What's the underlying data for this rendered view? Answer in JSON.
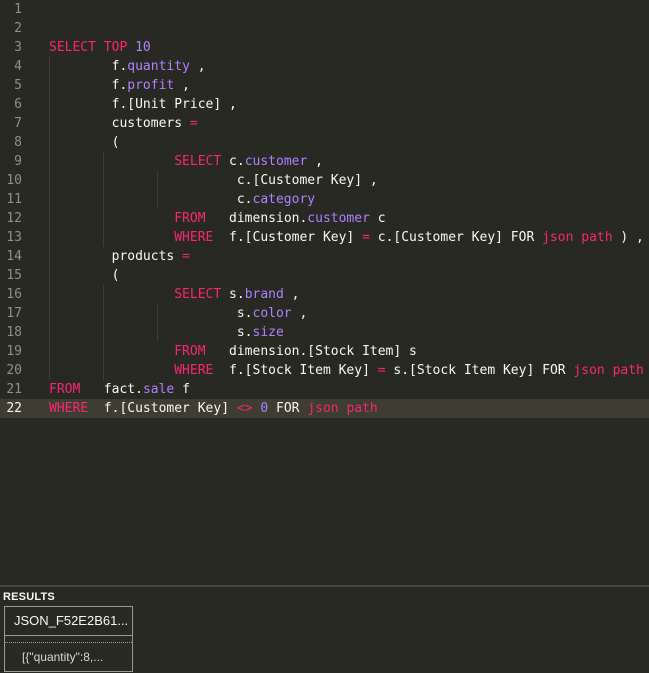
{
  "editor": {
    "current_line": 22,
    "lines": [
      {
        "n": "1",
        "tokens": []
      },
      {
        "n": "2",
        "tokens": []
      },
      {
        "n": "3",
        "tokens": [
          {
            "t": "SELECT",
            "c": "kw"
          },
          {
            "t": " ",
            "c": "pl"
          },
          {
            "t": "TOP",
            "c": "kw"
          },
          {
            "t": " ",
            "c": "pl"
          },
          {
            "t": "10",
            "c": "num"
          }
        ]
      },
      {
        "n": "4",
        "tokens": [
          {
            "t": "        f.",
            "c": "pl"
          },
          {
            "t": "quantity",
            "c": "prop"
          },
          {
            "t": " ,",
            "c": "pl"
          }
        ]
      },
      {
        "n": "5",
        "tokens": [
          {
            "t": "        f.",
            "c": "pl"
          },
          {
            "t": "profit",
            "c": "prop"
          },
          {
            "t": " ,",
            "c": "pl"
          }
        ]
      },
      {
        "n": "6",
        "tokens": [
          {
            "t": "        f.[Unit Price] ,",
            "c": "pl"
          }
        ]
      },
      {
        "n": "7",
        "tokens": [
          {
            "t": "        customers ",
            "c": "pl"
          },
          {
            "t": "=",
            "c": "op"
          }
        ]
      },
      {
        "n": "8",
        "tokens": [
          {
            "t": "        (",
            "c": "pl"
          }
        ]
      },
      {
        "n": "9",
        "tokens": [
          {
            "t": "                ",
            "c": "pl"
          },
          {
            "t": "SELECT",
            "c": "kw"
          },
          {
            "t": " c.",
            "c": "pl"
          },
          {
            "t": "customer",
            "c": "prop"
          },
          {
            "t": " ,",
            "c": "pl"
          }
        ]
      },
      {
        "n": "10",
        "tokens": [
          {
            "t": "                        c.[Customer Key] ,",
            "c": "pl"
          }
        ]
      },
      {
        "n": "11",
        "tokens": [
          {
            "t": "                        c.",
            "c": "pl"
          },
          {
            "t": "category",
            "c": "prop"
          }
        ]
      },
      {
        "n": "12",
        "tokens": [
          {
            "t": "                ",
            "c": "pl"
          },
          {
            "t": "FROM",
            "c": "kw"
          },
          {
            "t": "   dimension.",
            "c": "pl"
          },
          {
            "t": "customer",
            "c": "prop"
          },
          {
            "t": " c",
            "c": "pl"
          }
        ]
      },
      {
        "n": "13",
        "tokens": [
          {
            "t": "                ",
            "c": "pl"
          },
          {
            "t": "WHERE",
            "c": "kw"
          },
          {
            "t": "  f.[Customer Key] ",
            "c": "pl"
          },
          {
            "t": "=",
            "c": "op"
          },
          {
            "t": " c.[Customer Key] FOR ",
            "c": "pl"
          },
          {
            "t": "json",
            "c": "kw"
          },
          {
            "t": " ",
            "c": "pl"
          },
          {
            "t": "path",
            "c": "kw"
          },
          {
            "t": " ) ,",
            "c": "pl"
          }
        ]
      },
      {
        "n": "14",
        "tokens": [
          {
            "t": "        products ",
            "c": "pl"
          },
          {
            "t": "=",
            "c": "op"
          }
        ]
      },
      {
        "n": "15",
        "tokens": [
          {
            "t": "        (",
            "c": "pl"
          }
        ]
      },
      {
        "n": "16",
        "tokens": [
          {
            "t": "                ",
            "c": "pl"
          },
          {
            "t": "SELECT",
            "c": "kw"
          },
          {
            "t": " s.",
            "c": "pl"
          },
          {
            "t": "brand",
            "c": "prop"
          },
          {
            "t": " ,",
            "c": "pl"
          }
        ]
      },
      {
        "n": "17",
        "tokens": [
          {
            "t": "                        s.",
            "c": "pl"
          },
          {
            "t": "color",
            "c": "prop"
          },
          {
            "t": " ,",
            "c": "pl"
          }
        ]
      },
      {
        "n": "18",
        "tokens": [
          {
            "t": "                        s.",
            "c": "pl"
          },
          {
            "t": "size",
            "c": "prop"
          }
        ]
      },
      {
        "n": "19",
        "tokens": [
          {
            "t": "                ",
            "c": "pl"
          },
          {
            "t": "FROM",
            "c": "kw"
          },
          {
            "t": "   dimension.[Stock Item] s",
            "c": "pl"
          }
        ]
      },
      {
        "n": "20",
        "tokens": [
          {
            "t": "                ",
            "c": "pl"
          },
          {
            "t": "WHERE",
            "c": "kw"
          },
          {
            "t": "  f.[Stock Item Key] ",
            "c": "pl"
          },
          {
            "t": "=",
            "c": "op"
          },
          {
            "t": " s.[Stock Item Key] FOR ",
            "c": "pl"
          },
          {
            "t": "json",
            "c": "kw"
          },
          {
            "t": " ",
            "c": "pl"
          },
          {
            "t": "path",
            "c": "kw"
          },
          {
            "t": " )",
            "c": "pl"
          }
        ]
      },
      {
        "n": "21",
        "tokens": [
          {
            "t": "FROM",
            "c": "kw"
          },
          {
            "t": "   fact.",
            "c": "pl"
          },
          {
            "t": "sale",
            "c": "prop"
          },
          {
            "t": " f",
            "c": "pl"
          }
        ]
      },
      {
        "n": "22",
        "tokens": [
          {
            "t": "WHERE",
            "c": "kw"
          },
          {
            "t": "  f.[Customer Key] ",
            "c": "pl"
          },
          {
            "t": "<>",
            "c": "op"
          },
          {
            "t": " ",
            "c": "pl"
          },
          {
            "t": "0",
            "c": "num"
          },
          {
            "t": " FOR ",
            "c": "pl"
          },
          {
            "t": "json",
            "c": "kw"
          },
          {
            "t": " ",
            "c": "pl"
          },
          {
            "t": "path",
            "c": "kw"
          }
        ]
      }
    ]
  },
  "results": {
    "label": "RESULTS",
    "column_header": "JSON_F52E2B61...",
    "cell_value": "[{\"quantity\":8,..."
  },
  "colors": {
    "background": "#282923",
    "keyword": "#f92672",
    "number": "#ae81ff",
    "plain": "#f8f8f2",
    "gutter": "#8f908a",
    "current_line": "#3e3d32"
  }
}
